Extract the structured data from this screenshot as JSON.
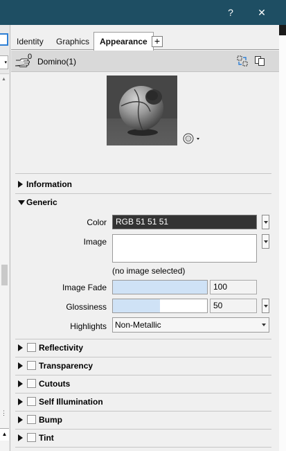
{
  "window": {
    "help_glyph": "?",
    "close_glyph": "✕"
  },
  "tabs": [
    {
      "label": "Identity"
    },
    {
      "label": "Graphics"
    },
    {
      "label": "Appearance",
      "active": true
    }
  ],
  "add_tab_glyph": "+",
  "object": {
    "name": "Domino(1)",
    "badge": "0"
  },
  "sections": {
    "information": {
      "title": "Information",
      "expanded": false
    },
    "generic": {
      "title": "Generic",
      "expanded": true
    }
  },
  "generic": {
    "color_label": "Color",
    "color_value": "RGB 51 51 51",
    "color_hex": "#333333",
    "image_label": "Image",
    "no_image_text": "(no image selected)",
    "image_fade_label": "Image Fade",
    "image_fade_value": "100",
    "image_fade_fraction": 1.0,
    "glossiness_label": "Glossiness",
    "glossiness_value": "50",
    "glossiness_fraction": 0.5,
    "highlights_label": "Highlights",
    "highlights_value": "Non-Metallic"
  },
  "collapsed_sections": [
    {
      "title": "Reflectivity",
      "checked": false
    },
    {
      "title": "Transparency",
      "checked": false
    },
    {
      "title": "Cutouts",
      "checked": false
    },
    {
      "title": "Self Illumination",
      "checked": false
    },
    {
      "title": "Bump",
      "checked": false
    },
    {
      "title": "Tint",
      "checked": false
    }
  ],
  "colors": {
    "title_bar": "#1e4e63",
    "slider_fill": "#cfe2f6",
    "active_tab_border": "#2d7fd5"
  }
}
